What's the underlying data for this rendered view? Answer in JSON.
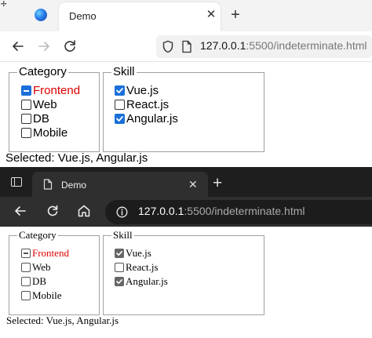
{
  "top_browser": {
    "corner_glyph": "✢",
    "tab": {
      "title": "Demo",
      "close": "✕"
    },
    "new_tab": "+",
    "address": {
      "host": "127.0.0.1",
      "rest": ":5500/indeterminate.html"
    }
  },
  "bottom_browser": {
    "tab": {
      "title": "Demo",
      "close": "✕"
    },
    "new_tab": "+",
    "address": {
      "host": "127.0.0.1",
      "rest": ":5500/indeterminate.html"
    }
  },
  "form": {
    "category": {
      "legend": "Category",
      "items": [
        {
          "label": "Frontend",
          "state": "indeterminate",
          "color": "#e00000"
        },
        {
          "label": "Web",
          "state": "unchecked"
        },
        {
          "label": "DB",
          "state": "unchecked"
        },
        {
          "label": "Mobile",
          "state": "unchecked"
        }
      ]
    },
    "skill": {
      "legend": "Skill",
      "items": [
        {
          "label": "Vue.js",
          "state": "checked"
        },
        {
          "label": "React.js",
          "state": "unchecked"
        },
        {
          "label": "Angular.js",
          "state": "checked"
        }
      ]
    },
    "selected": "Selected: Vue.js, Angular.js"
  },
  "colors": {
    "checkbox_accent_top": "#1b6fd8",
    "checkbox_accent_bottom": "#666666"
  }
}
